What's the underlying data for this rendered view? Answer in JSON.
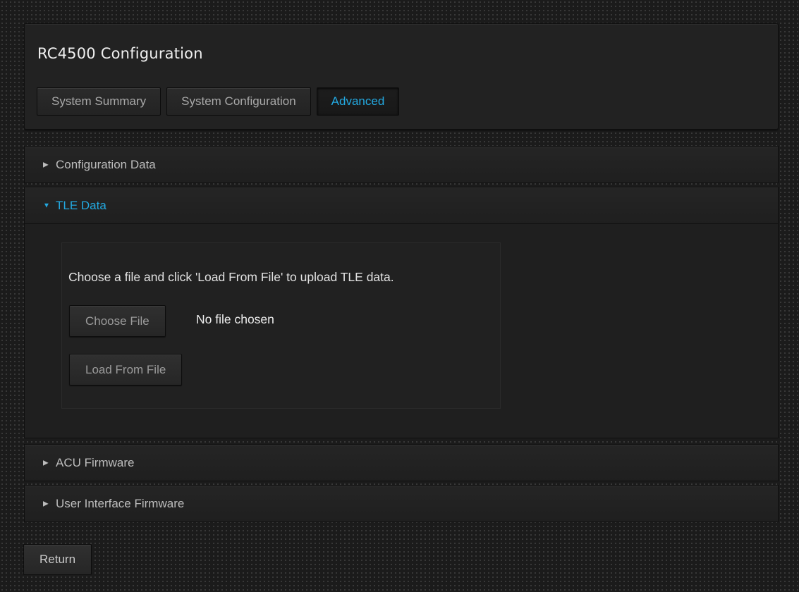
{
  "app": {
    "title": "RC4500 Configuration"
  },
  "tabs": [
    {
      "label": "System Summary",
      "active": false
    },
    {
      "label": "System Configuration",
      "active": false
    },
    {
      "label": "Advanced",
      "active": true
    }
  ],
  "sections": [
    {
      "label": "Configuration Data",
      "expanded": false,
      "icon": "caret-right-icon"
    },
    {
      "label": "TLE Data",
      "expanded": true,
      "icon": "caret-down-icon"
    },
    {
      "label": "ACU Firmware",
      "expanded": false,
      "icon": "caret-right-icon"
    },
    {
      "label": "User Interface Firmware",
      "expanded": false,
      "icon": "caret-right-icon"
    }
  ],
  "tle": {
    "instructions": "Choose a file and click 'Load From File' to upload TLE data.",
    "choose_file_label": "Choose File",
    "file_status": "No file chosen",
    "load_button_label": "Load From File"
  },
  "footer": {
    "return_label": "Return"
  },
  "colors": {
    "accent": "#23a9e1",
    "background": "#1b1b1b",
    "panel": "#222222"
  }
}
